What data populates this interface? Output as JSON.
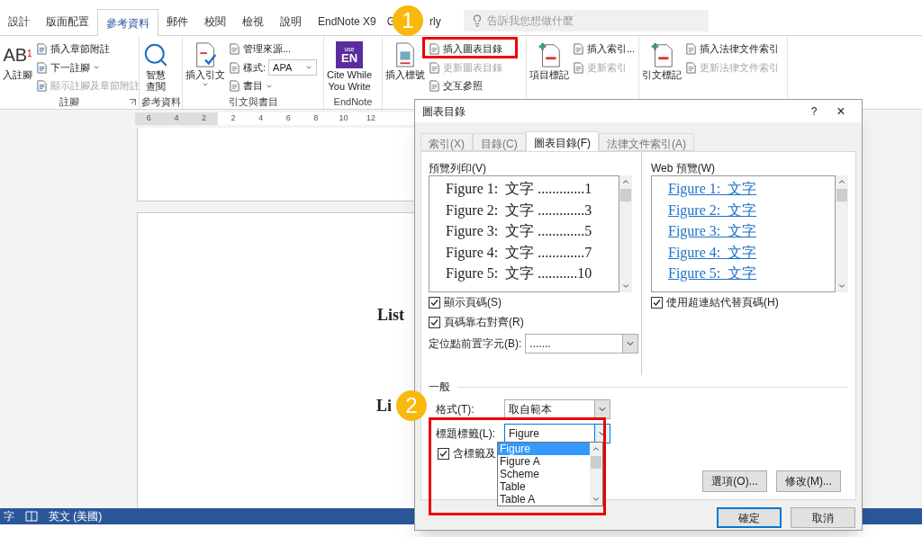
{
  "ribbon_tabs": [
    {
      "label": "設計",
      "selected": false
    },
    {
      "label": "版面配置",
      "selected": false
    },
    {
      "label": "參考資料",
      "selected": true
    },
    {
      "label": "郵件",
      "selected": false
    },
    {
      "label": "校閱",
      "selected": false
    },
    {
      "label": "檢視",
      "selected": false
    },
    {
      "label": "說明",
      "selected": false
    },
    {
      "label": "EndNote X9",
      "selected": false
    },
    {
      "label": "G",
      "label_end": "rly",
      "selected": false
    }
  ],
  "search": {
    "placeholder": "告訴我您想做什麼"
  },
  "ribbon_groups": [
    {
      "label": "註腳",
      "launcher": true,
      "items": [
        {
          "kind": "large",
          "lines": [
            "入註腳"
          ],
          "icon_text": "AB$^{1}$",
          "dropdown": false
        },
        {
          "kind": "small",
          "label": "插入章節附註",
          "disabled": false,
          "dropdown": false
        },
        {
          "kind": "small",
          "label": "下一註腳",
          "disabled": false,
          "dropdown": true
        },
        {
          "kind": "small",
          "label": "顯示註腳及章節附註",
          "disabled": true,
          "dropdown": false
        }
      ]
    },
    {
      "label": "參考資料",
      "items": [
        {
          "kind": "large",
          "lines": [
            "智慧",
            "查閱"
          ],
          "dropdown": false
        }
      ]
    },
    {
      "label": "引文與書目",
      "items": [
        {
          "kind": "large",
          "lines": [
            "插入引文"
          ],
          "dropdown": true
        },
        {
          "kind": "small",
          "label": "管理來源...",
          "disabled": false,
          "dropdown": false
        },
        {
          "kind": "select",
          "label": "樣式:",
          "value": "APA"
        },
        {
          "kind": "small",
          "label": "書目",
          "disabled": false,
          "dropdown": true
        }
      ]
    },
    {
      "label": "EndNote",
      "items": [
        {
          "kind": "large",
          "lines": [
            "Cite While",
            "You Write"
          ],
          "icon_text": "EN",
          "icon_sub": "use",
          "dropdown": false
        }
      ]
    },
    {
      "items": [
        {
          "kind": "large",
          "lines": [
            "插入標號"
          ],
          "dropdown": false
        },
        {
          "kind": "small",
          "label": "插入圖表目錄",
          "disabled": false,
          "dropdown": false
        },
        {
          "kind": "small",
          "label": "更新圖表目錄",
          "disabled": true,
          "dropdown": false
        },
        {
          "kind": "small",
          "label": "交互參照",
          "disabled": false,
          "dropdown": false
        }
      ]
    },
    {
      "items": [
        {
          "kind": "large",
          "lines": [
            "項目標記"
          ],
          "dropdown": false
        },
        {
          "kind": "small",
          "label": "插入索引...",
          "disabled": false,
          "dropdown": false
        },
        {
          "kind": "small",
          "label": "更新索引",
          "disabled": true,
          "dropdown": false
        }
      ]
    },
    {
      "items": [
        {
          "kind": "large",
          "lines": [
            "引文標記"
          ],
          "dropdown": false
        },
        {
          "kind": "small",
          "label": "插入法律文件索引",
          "disabled": false,
          "dropdown": false
        },
        {
          "kind": "small",
          "label": "更新法律文件索引",
          "disabled": true,
          "dropdown": false
        }
      ]
    }
  ],
  "ruler": [
    "6",
    "4",
    "2",
    "2",
    "4",
    "6",
    "8",
    "10",
    "12"
  ],
  "document": {
    "headings": [
      "List",
      "Li"
    ]
  },
  "status_bar": {
    "items": [
      "字",
      "英文 (美國)"
    ]
  },
  "dialog": {
    "title": "圖表目錄",
    "help": "?",
    "close": "×",
    "tabs": [
      {
        "label": "索引(X)",
        "selected": false
      },
      {
        "label": "目錄(C)",
        "selected": false
      },
      {
        "label": "圖表目錄(F)",
        "selected": true
      },
      {
        "label": "法律文件索引(A)",
        "selected": false
      }
    ],
    "print_preview": {
      "label": "預覽列印(V)",
      "lines": [
        "Figure 1:  文字 .............1",
        "Figure 2:  文字 .............3",
        "Figure 3:  文字 .............5",
        "Figure 4:  文字 .............7",
        "Figure 5:  文字 ...........10"
      ]
    },
    "web_preview": {
      "label": "Web 預覽(W)",
      "lines": [
        "Figure 1:  文字",
        "Figure 2:  文字",
        "Figure 3:  文字",
        "Figure 4:  文字",
        "Figure 5:  文字"
      ]
    },
    "show_page_numbers": {
      "label": "顯示頁碼(S)",
      "checked": true
    },
    "right_align": {
      "label": "頁碼靠右對齊(R)",
      "checked": true
    },
    "tab_leader": {
      "label": "定位點前置字元(B):",
      "value": "......."
    },
    "use_hyperlinks": {
      "label": "使用超連結代替頁碼(H)",
      "checked": true
    },
    "general": {
      "label": "一般",
      "format": {
        "label": "格式(T):",
        "value": "取自範本"
      },
      "caption_label": {
        "label": "標題標籤(L):",
        "value": "Figure",
        "open": true,
        "options": [
          {
            "label": "Figure",
            "selected": true
          },
          {
            "label": "Figure A",
            "selected": false
          },
          {
            "label": "Scheme",
            "selected": false
          },
          {
            "label": "Table",
            "selected": false
          },
          {
            "label": "Table A",
            "selected": false
          }
        ]
      },
      "include_label": {
        "label": "含標籤及",
        "checked": true
      }
    },
    "buttons": [
      "選項(O)...",
      "修改(M)...",
      "確定",
      "取消"
    ]
  },
  "annotations": [
    {
      "label": "1"
    },
    {
      "label": "2"
    }
  ]
}
